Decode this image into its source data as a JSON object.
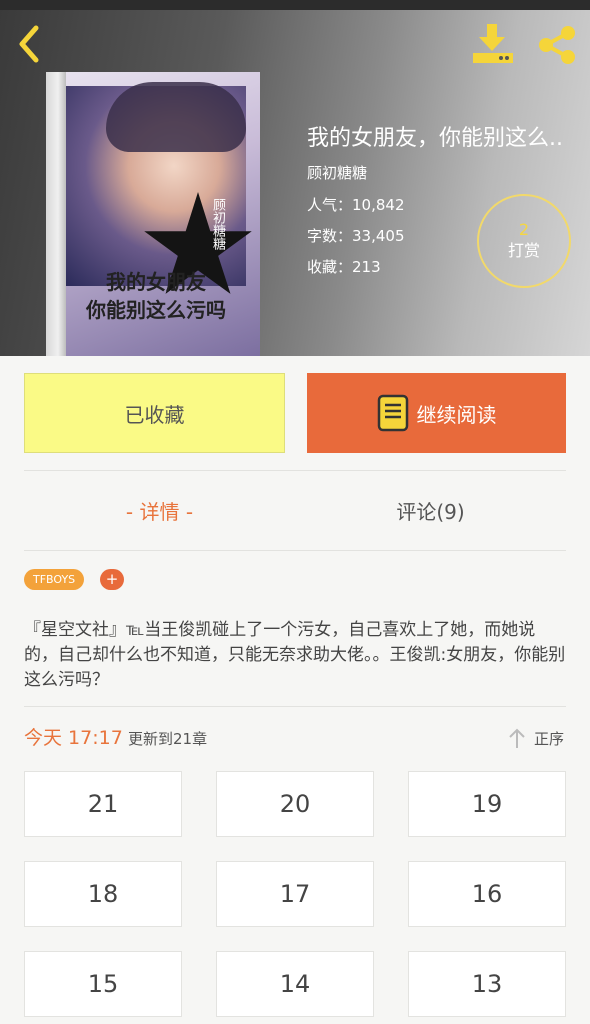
{
  "book": {
    "title": "我的女朋友，你能别这么..",
    "author": "顾初糖糖",
    "popularity": "人气：10,842",
    "word_count": "字数：33,405",
    "favorites": "收藏：213",
    "reward_count": "2",
    "reward_label": "打赏",
    "cover_title": "我的女朋友\n你能别这么污吗",
    "cover_author": "顾初糖糖"
  },
  "actions": {
    "collected_label": "已收藏",
    "continue_label": "继续阅读"
  },
  "tabs": {
    "details": "- 详情 -",
    "comments": "评论(9)"
  },
  "tags": {
    "items": [
      "TFBOYS"
    ],
    "add_label": "+"
  },
  "description": "『星空文社』℡当王俊凯碰上了一个污女，自己喜欢上了她，而她说的，自己却什么也不知道，只能无奈求助大佬。。王俊凯:女朋友，你能别这么污吗？",
  "update": {
    "time": "今天 17:17",
    "text": "更新到21章",
    "sort_label": "正序"
  },
  "chapters": [
    "21",
    "20",
    "19",
    "18",
    "17",
    "16",
    "15",
    "14",
    "13"
  ],
  "colors": {
    "accent": "#e8743c",
    "continue_button": "#e86a3b",
    "collected_button": "#fafa86",
    "tag": "#f3a23a",
    "reward_ring": "#f2d96a"
  },
  "icons": {
    "back": "back-arrow-icon",
    "download": "download-icon",
    "share": "share-icon",
    "book": "book-icon",
    "sort": "sort-arrow-icon"
  }
}
